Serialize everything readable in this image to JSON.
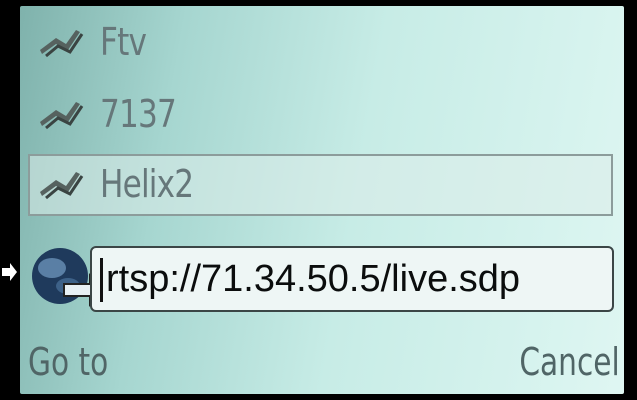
{
  "bookmarks": [
    {
      "label": "Ftv",
      "icon": "bookmark-icon"
    },
    {
      "label": "7137",
      "icon": "bookmark-icon"
    },
    {
      "label": "Helix2",
      "icon": "bookmark-icon",
      "selected": true
    }
  ],
  "address": {
    "value": "rtsp://71.34.50.5/live.sdp",
    "icon": "globe-icon"
  },
  "softkeys": {
    "left": "Go to",
    "right": "Cancel"
  },
  "colors": {
    "screen_bg": "#c7ece6",
    "text_dim": "#66777a",
    "field_border": "#3b4646"
  }
}
